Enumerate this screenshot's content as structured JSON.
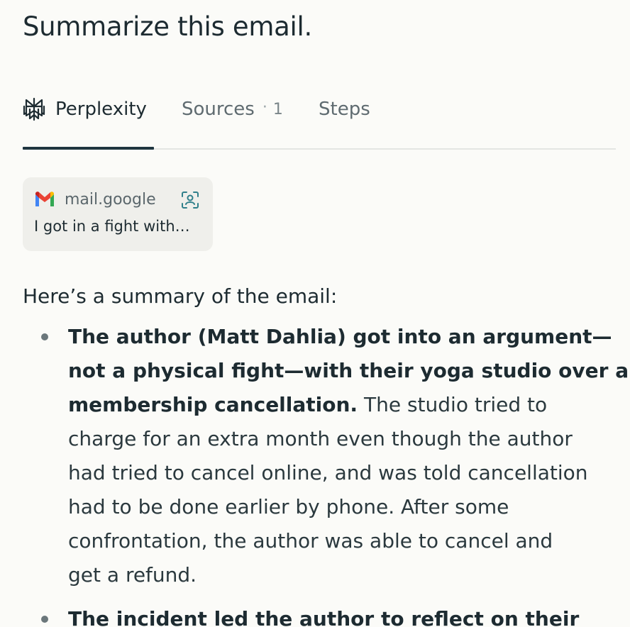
{
  "query": "Summarize this email.",
  "tabs": {
    "answer": {
      "label": "Perplexity",
      "icon": "perplexity-logo-icon",
      "active": true
    },
    "sources": {
      "label": "Sources",
      "separator": "·",
      "count": "1"
    },
    "steps": {
      "label": "Steps"
    }
  },
  "source": {
    "icon": "gmail-icon",
    "domain": "mail.google",
    "action_icon": "screen-capture-icon",
    "title": "I got in a fight with…"
  },
  "answer": {
    "intro": "Here’s a summary of the email:",
    "bullets": [
      {
        "bold_lines": [
          "The author (Matt Dahlia) got into an argument—",
          "not a physical fight—with their yoga studio over a",
          "membership cancellation."
        ],
        "text_first": " The studio tried to",
        "text_lines": [
          "charge for an extra month even though the author",
          "had tried to cancel online, and was told cancellation",
          "had to be done earlier by phone. After some",
          "confrontation, the author was able to cancel and",
          "get a refund."
        ]
      },
      {
        "bold_lines": [
          "The incident led the author to reflect on their"
        ]
      }
    ]
  },
  "colors": {
    "background": "#fbfbf8",
    "text": "#1d2b31",
    "muted": "#5f6b70",
    "active_underline": "#1f3640",
    "card": "#efefeb",
    "accent_teal": "#2f7f8a"
  }
}
